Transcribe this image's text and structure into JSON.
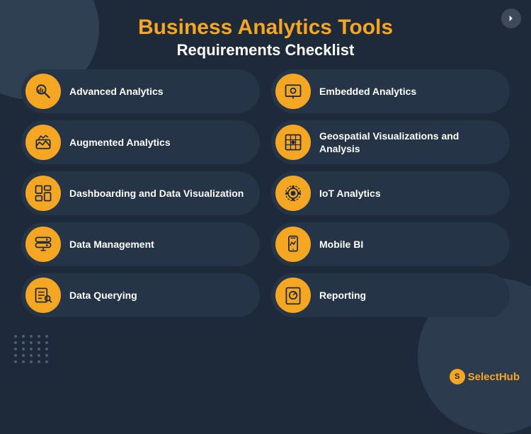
{
  "header": {
    "title": "Business Analytics Tools",
    "subtitle": "Requirements Checklist"
  },
  "cards": [
    {
      "id": "advanced-analytics",
      "label": "Advanced Analytics",
      "icon": "advanced"
    },
    {
      "id": "embedded-analytics",
      "label": "Embedded Analytics",
      "icon": "embedded"
    },
    {
      "id": "augmented-analytics",
      "label": "Augmented Analytics",
      "icon": "augmented"
    },
    {
      "id": "geospatial",
      "label": "Geospatial Visualizations and Analysis",
      "icon": "geospatial"
    },
    {
      "id": "dashboarding",
      "label": "Dashboarding and Data Visualization",
      "icon": "dashboard"
    },
    {
      "id": "iot-analytics",
      "label": "IoT Analytics",
      "icon": "iot"
    },
    {
      "id": "data-management",
      "label": "Data Management",
      "icon": "data-mgmt"
    },
    {
      "id": "mobile-bi",
      "label": "Mobile BI",
      "icon": "mobile"
    },
    {
      "id": "data-querying",
      "label": "Data Querying",
      "icon": "query"
    },
    {
      "id": "reporting",
      "label": "Reporting",
      "icon": "reporting"
    }
  ],
  "logo": {
    "text_white": "Select",
    "text_yellow": "Hub"
  }
}
